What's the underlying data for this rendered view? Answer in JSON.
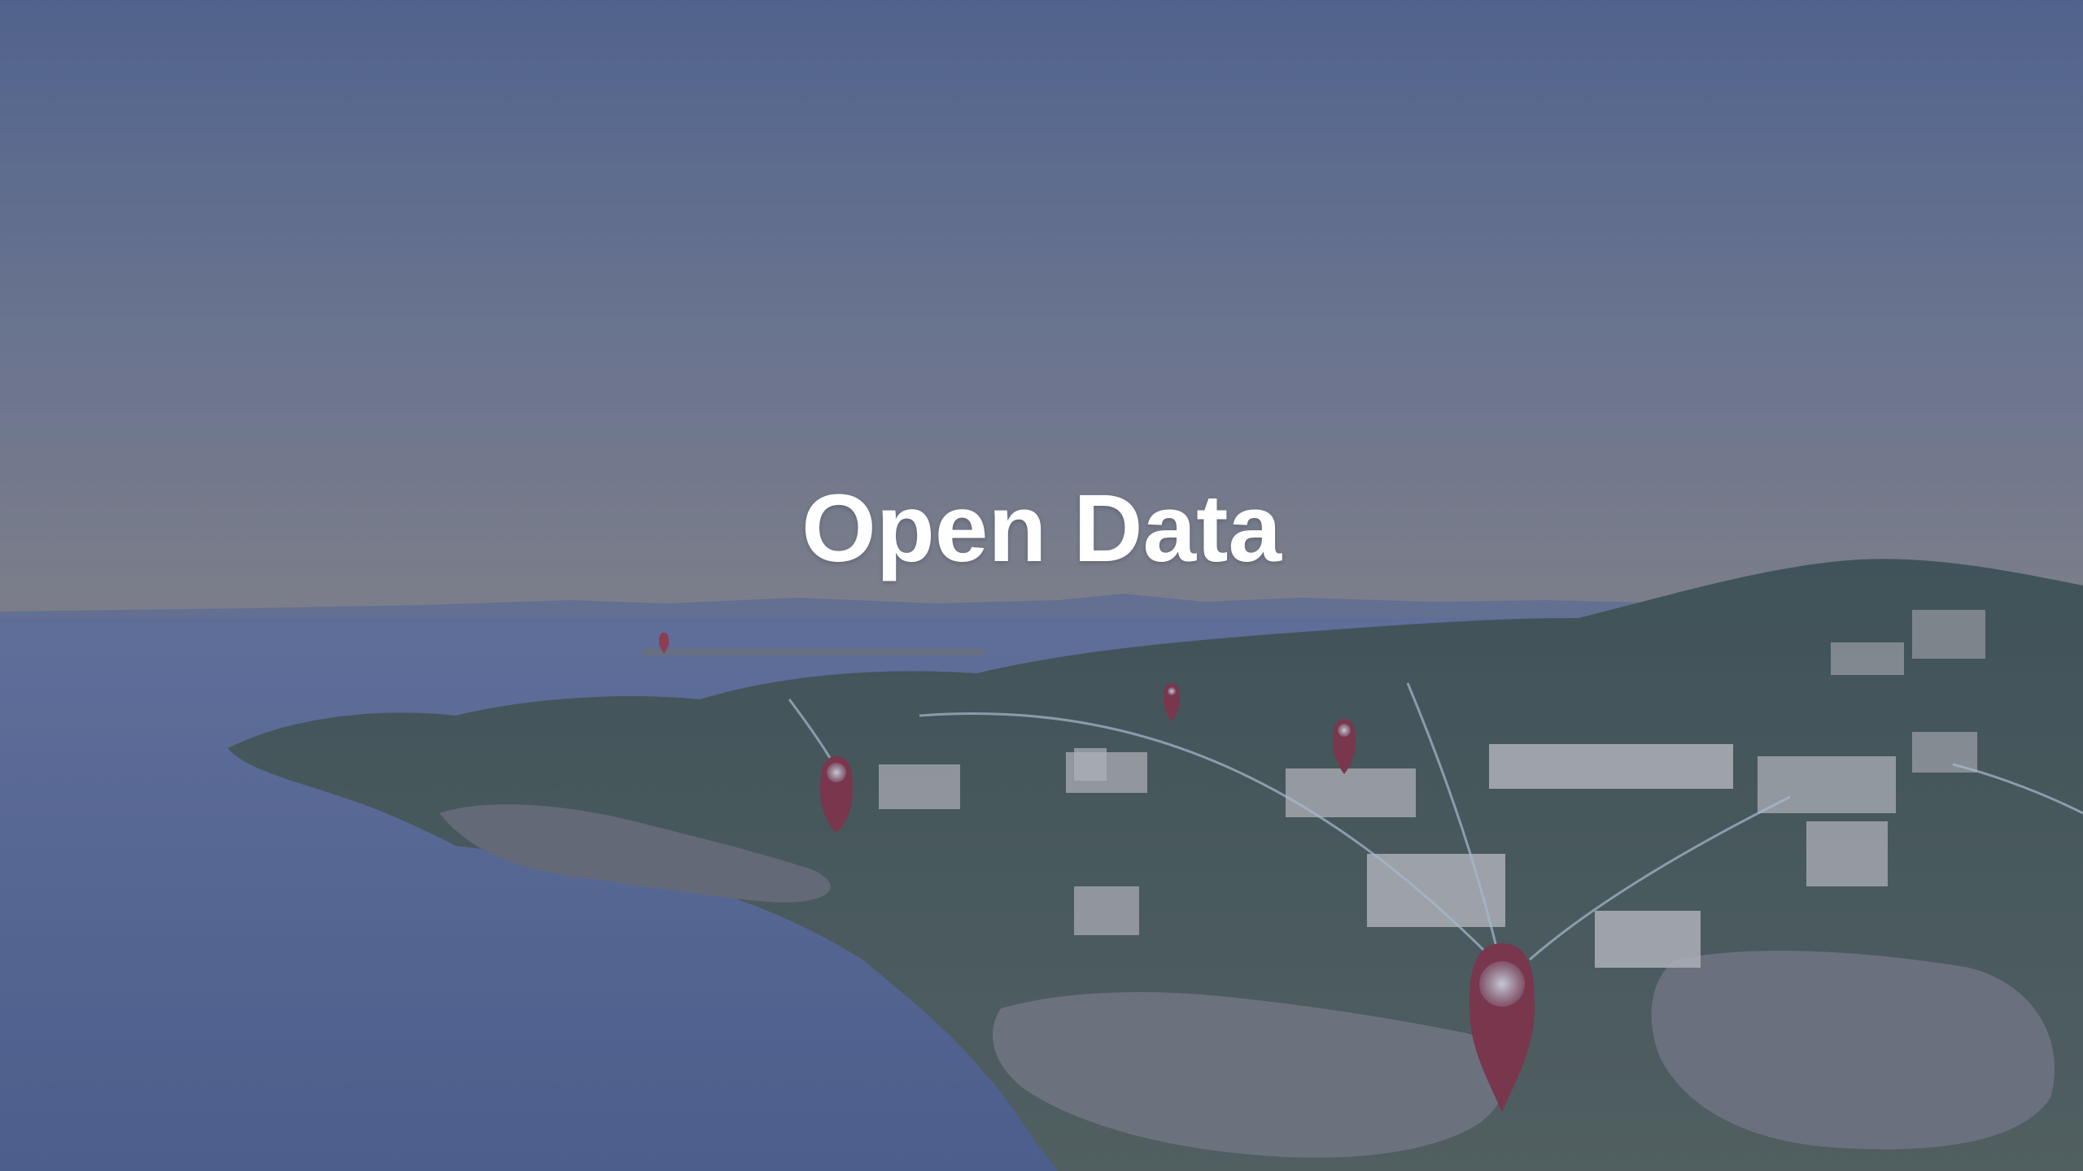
{
  "hero": {
    "title": "Open Data",
    "background_description_icon": "coastal-town-aerial-photo",
    "pin_icon": "map-pin-icon",
    "colors": {
      "sky_top": "#5b6b8f",
      "sky_horizon": "#8a8a95",
      "water": "#5f6f98",
      "land": "#4b5a4e",
      "rock": "#7a7a7e",
      "pin": "#8c2a36",
      "overlay": "rgba(70,90,135,0.28)",
      "title": "#ffffff"
    }
  }
}
